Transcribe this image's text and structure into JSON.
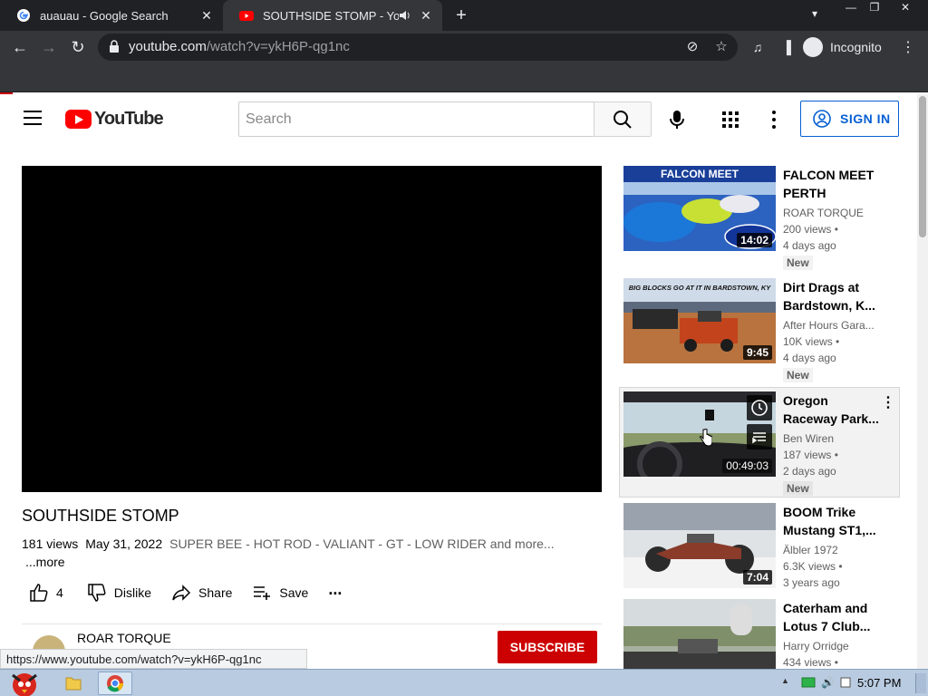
{
  "browser": {
    "tabs": [
      {
        "title": "auauau - Google Search",
        "close": "✕"
      },
      {
        "title": "SOUTHSIDE STOMP - YouT",
        "close": "✕"
      }
    ],
    "new_tab": "+",
    "url_host": "youtube.com",
    "url_path": "/watch?v=ykH6P-qg1nc",
    "incognito_label": "Incognito"
  },
  "header": {
    "logo_text": "YouTube",
    "search_placeholder": "Search",
    "signin_label": "SIGN IN"
  },
  "video": {
    "title": "SOUTHSIDE STOMP",
    "views": "181 views",
    "date": "May 31, 2022",
    "description": "SUPER BEE - HOT ROD - VALIANT - GT - LOW RIDER and more...",
    "more_label": "...more",
    "likes": "4",
    "dislike_label": "Dislike",
    "share_label": "Share",
    "save_label": "Save",
    "more_actions": "..."
  },
  "channel": {
    "name": "ROAR TORQUE",
    "subscribe_label": "SUBSCRIBE"
  },
  "recommendations": [
    {
      "title": "FALCON MEET PERTH",
      "channel": "ROAR TORQUE",
      "views": "200 views •",
      "ago": "4 days ago",
      "badge": "New",
      "duration": "14:02"
    },
    {
      "title": "Dirt Drags at Bardstown, K...",
      "channel": "After Hours Gara...",
      "views": "10K views •",
      "ago": "4 days ago",
      "badge": "New",
      "duration": "9:45"
    },
    {
      "title": "Oregon Raceway Park...",
      "channel": "Ben Wiren",
      "views": "187 views •",
      "ago": "2 days ago",
      "badge": "New",
      "duration": "00:49:03"
    },
    {
      "title": "BOOM Trike Mustang ST1,...",
      "channel": "Älbler 1972",
      "views": "6.3K views •",
      "ago": "3 years ago",
      "badge": "",
      "duration": "7:04"
    },
    {
      "title": "Caterham and Lotus 7 Club...",
      "channel": "Harry Orridge",
      "views": "434 views •",
      "ago": "",
      "badge": "",
      "duration": ""
    }
  ],
  "thumb_text": {
    "falcon": "FALCON MEET",
    "bardstown": "BIG BLOCKS GO AT IT IN BARDSTOWN, KY"
  },
  "status_url": "https://www.youtube.com/watch?v=ykH6P-qg1nc",
  "taskbar": {
    "clock": "5:07 PM"
  },
  "colors": {
    "youtube_red": "#ff0000",
    "subscribe_red": "#cc0000",
    "signin_blue": "#065fd4",
    "chrome_dark": "#202124",
    "chrome_toolbar": "#35363a"
  }
}
